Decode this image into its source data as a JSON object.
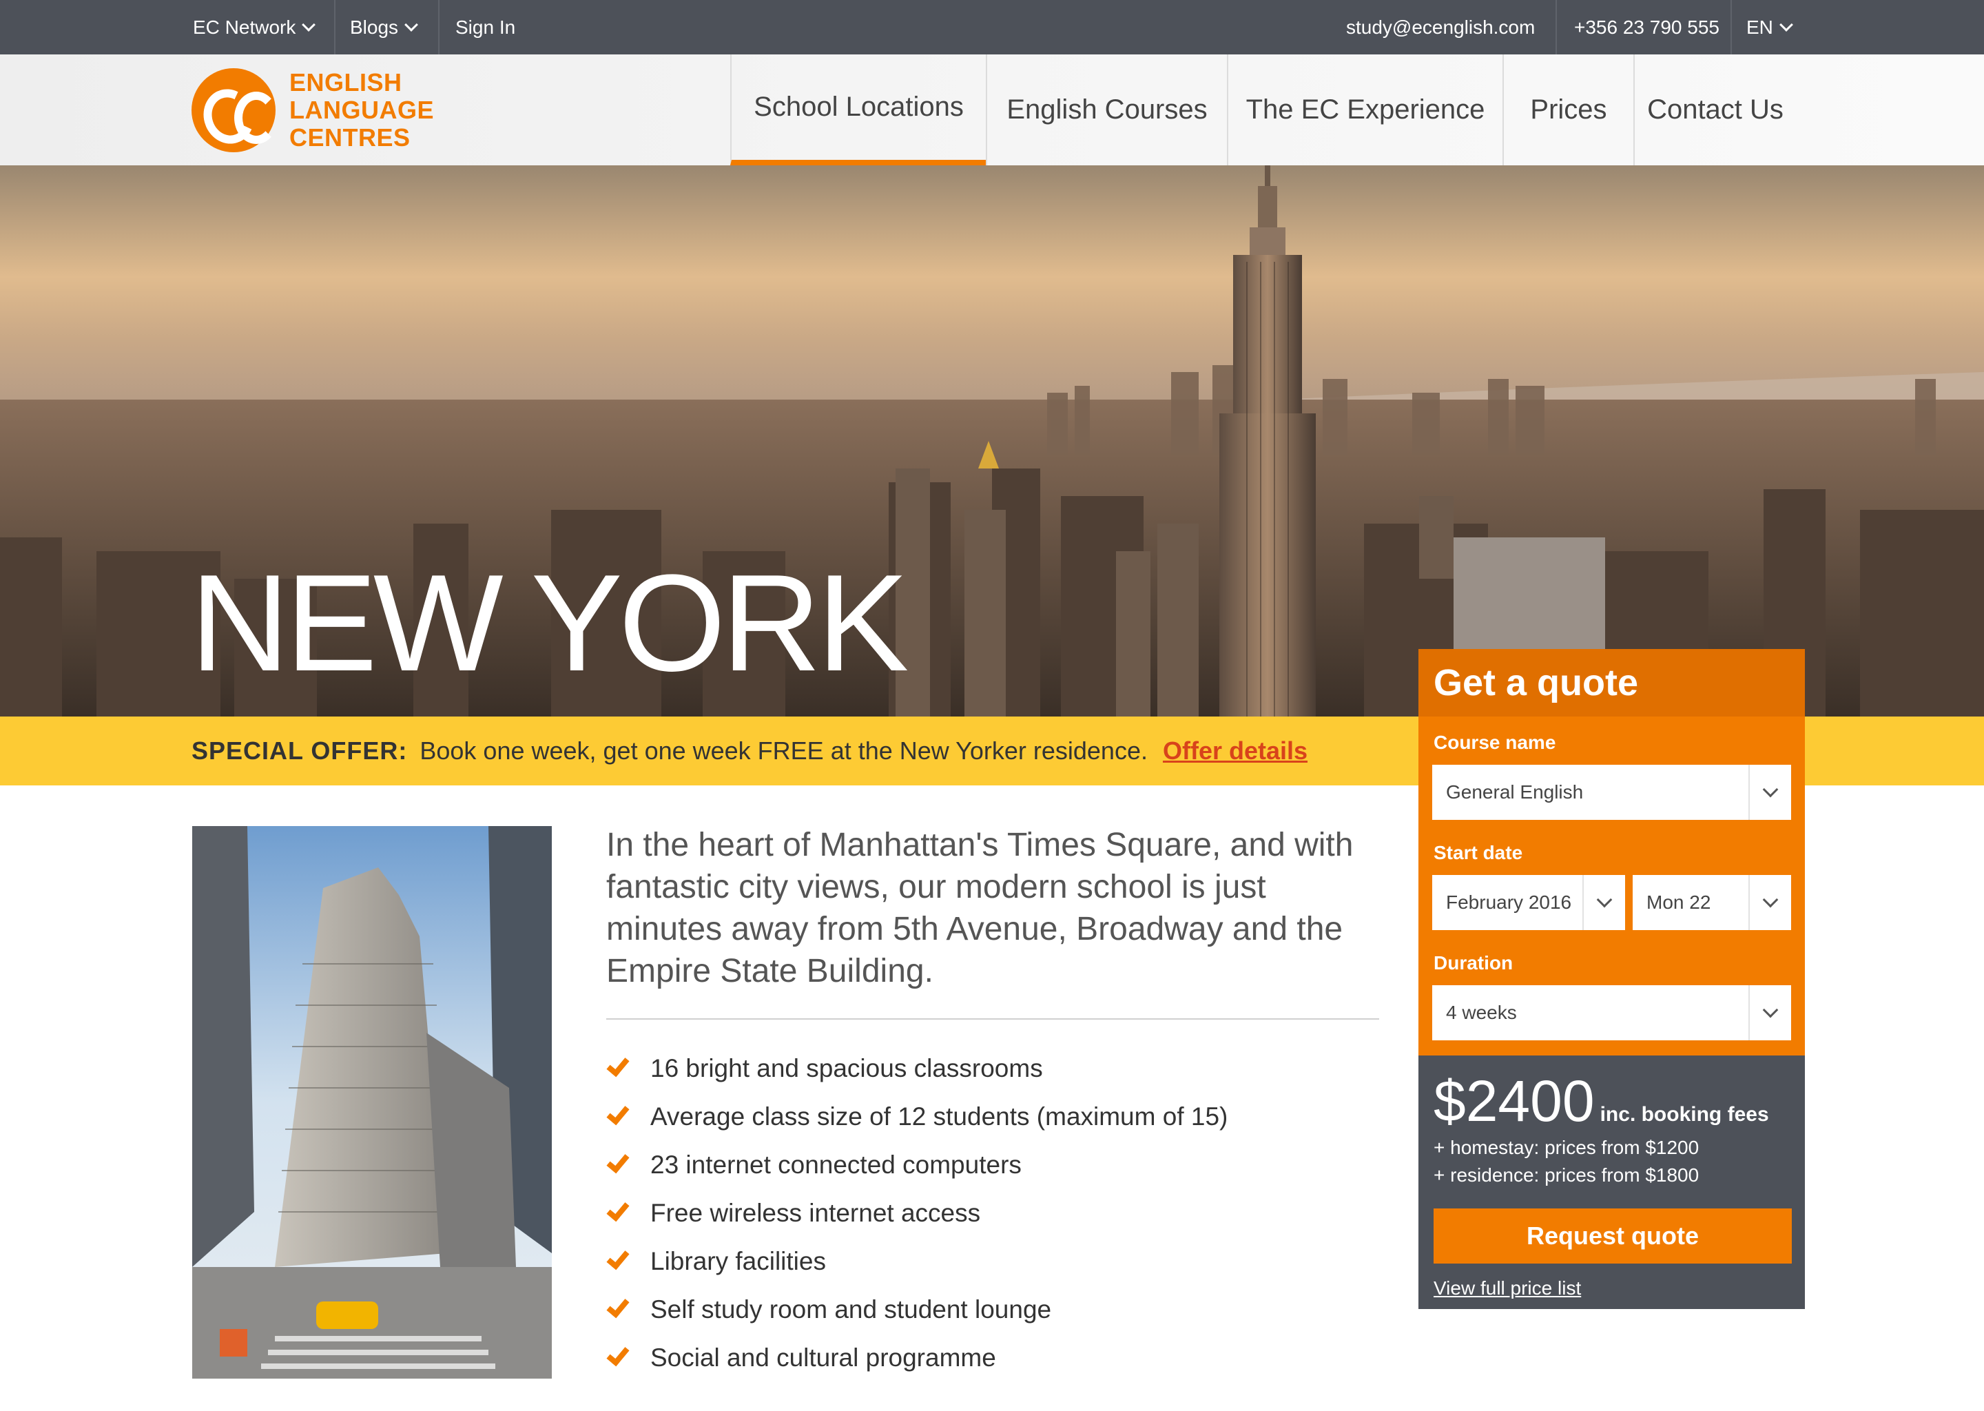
{
  "topbar": {
    "ec_network": "EC Network",
    "blogs": "Blogs",
    "sign_in": "Sign In",
    "email": "study@ecenglish.com",
    "phone": "+356 23 790 555",
    "language": "EN"
  },
  "logo": {
    "line1": "ENGLISH",
    "line2": "LANGUAGE",
    "line3": "CENTRES"
  },
  "nav": {
    "items": [
      {
        "label": "School Locations",
        "active": true
      },
      {
        "label": "English Courses"
      },
      {
        "label": "The EC Experience"
      },
      {
        "label": "Prices"
      },
      {
        "label": "Contact Us"
      }
    ]
  },
  "hero": {
    "title": "NEW YORK"
  },
  "offer": {
    "label": "SPECIAL OFFER:",
    "text": "Book one week, get one week FREE at the New Yorker residence.",
    "link": "Offer details"
  },
  "content": {
    "intro": "In the heart of Manhattan's Times Square, and with fantastic city views, our modern school is just minutes away from 5th Avenue, Broadway and the Empire State Building.",
    "features": [
      "16 bright and spacious classrooms",
      "Average class size of 12 students (maximum of 15)",
      "23 internet connected computers",
      "Free wireless internet access",
      "Library facilities",
      "Self study room and student lounge",
      "Social and cultural programme"
    ]
  },
  "quote": {
    "title": "Get a quote",
    "course_label": "Course name",
    "course_value": "General English",
    "start_label": "Start date",
    "month_value": "February 2016",
    "day_value": "Mon 22",
    "duration_label": "Duration",
    "duration_value": "4 weeks",
    "price": "$2400",
    "price_note": "inc. booking fees",
    "homestay": "+ homestay: prices from $1200",
    "residence": "+ residence: prices from $1800",
    "request_button": "Request quote",
    "full_price_link": "View full price list"
  },
  "colors": {
    "brand_orange": "#f27c00",
    "topbar": "#4d5159",
    "offer_yellow": "#fdcb34",
    "offer_link": "#d8431b"
  }
}
